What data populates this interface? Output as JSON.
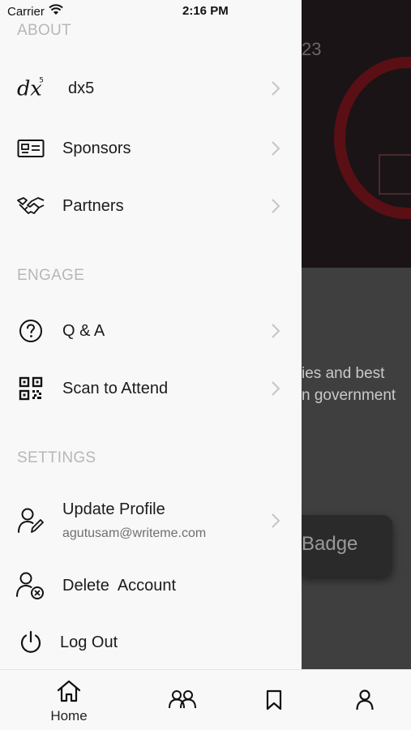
{
  "status_bar": {
    "carrier": "Carrier",
    "time": "2:16 PM"
  },
  "background": {
    "year_fragment": "23",
    "text_lines": [
      "ies and best",
      "n government"
    ],
    "badge_label": "Badge"
  },
  "drawer": {
    "about": {
      "title": "ABOUT",
      "items": [
        {
          "label": "dx5",
          "icon": "dx5-logo-icon"
        },
        {
          "label": "Sponsors",
          "icon": "id-card-icon"
        },
        {
          "label": "Partners",
          "icon": "handshake-icon"
        }
      ]
    },
    "engage": {
      "title": "ENGAGE",
      "items": [
        {
          "label": "Q & A",
          "icon": "question-circle-icon"
        },
        {
          "label": "Scan to Attend",
          "icon": "qr-code-icon"
        }
      ]
    },
    "settings": {
      "title": "SETTINGS",
      "items": [
        {
          "label": "Update Profile",
          "sublabel": "agutusam@writeme.com",
          "icon": "user-edit-icon"
        },
        {
          "label": "Delete  Account",
          "icon": "user-delete-icon"
        },
        {
          "label": "Log Out",
          "icon": "power-icon"
        }
      ]
    }
  },
  "tabbar": {
    "tabs": [
      {
        "label": "Home",
        "icon": "home-icon",
        "selected": true
      },
      {
        "label": "",
        "icon": "people-icon"
      },
      {
        "label": "",
        "icon": "bookmark-icon"
      },
      {
        "label": "",
        "icon": "profile-icon"
      }
    ]
  },
  "colors": {
    "drawer_bg": "#f8f8f8",
    "section_title": "#b7b7b7",
    "overlay_dark": "#3f3f3f",
    "accent_red": "#5a0f14"
  }
}
